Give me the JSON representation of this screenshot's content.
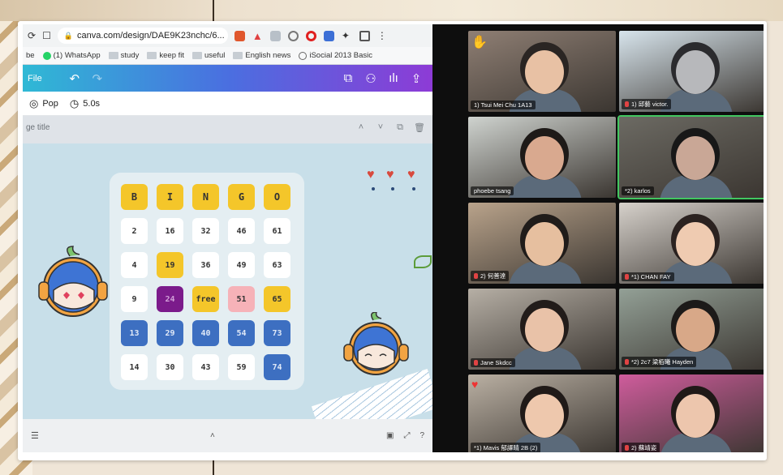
{
  "browser": {
    "url": "canva.com/design/DAE9K23nchc/6...",
    "bookmarks": [
      "be",
      "(1) WhatsApp",
      "study",
      "keep fit",
      "useful",
      "English news",
      "iSocial 2013 Basic"
    ]
  },
  "canva": {
    "file_label": "File",
    "animation_label": "Pop",
    "duration_label": "5.0s",
    "page_title_placeholder": "ge title"
  },
  "bingo": {
    "header": [
      "B",
      "I",
      "N",
      "G",
      "O"
    ],
    "rows": [
      [
        {
          "v": "2",
          "c": "white"
        },
        {
          "v": "16",
          "c": "white"
        },
        {
          "v": "32",
          "c": "white"
        },
        {
          "v": "46",
          "c": "white"
        },
        {
          "v": "61",
          "c": "white"
        }
      ],
      [
        {
          "v": "4",
          "c": "white"
        },
        {
          "v": "19",
          "c": "yellow"
        },
        {
          "v": "36",
          "c": "white"
        },
        {
          "v": "49",
          "c": "white"
        },
        {
          "v": "63",
          "c": "white"
        }
      ],
      [
        {
          "v": "9",
          "c": "white"
        },
        {
          "v": "24",
          "c": "purple"
        },
        {
          "v": "free",
          "c": "yellow"
        },
        {
          "v": "51",
          "c": "pink"
        },
        {
          "v": "65",
          "c": "yellow"
        }
      ],
      [
        {
          "v": "13",
          "c": "blue"
        },
        {
          "v": "29",
          "c": "blue"
        },
        {
          "v": "40",
          "c": "blue"
        },
        {
          "v": "54",
          "c": "blue"
        },
        {
          "v": "73",
          "c": "blue"
        }
      ],
      [
        {
          "v": "14",
          "c": "white"
        },
        {
          "v": "30",
          "c": "white"
        },
        {
          "v": "43",
          "c": "white"
        },
        {
          "v": "59",
          "c": "white"
        },
        {
          "v": "74",
          "c": "blue"
        }
      ]
    ]
  },
  "participants": [
    {
      "name": "1)  Tsui Mei Chu 1A13",
      "bg": "#8f7f74",
      "skin": "#e8c1a4",
      "hair": "#2a2523",
      "hand": true
    },
    {
      "name": "1)  邱藝 victor.",
      "bg": "#d7e4ec",
      "skin": "#b7b8bb",
      "hair": "#2b2b2e",
      "mic": true
    },
    {
      "name": "phoebe tsang",
      "bg": "#cfd3cf",
      "skin": "#d9a98f",
      "hair": "#1e1a18"
    },
    {
      "name": "*2)  karlos",
      "bg": "#6c6a63",
      "skin": "#c9a796",
      "hair": "#181818",
      "active": true
    },
    {
      "name": "2)  何善達",
      "bg": "#b9a38b",
      "skin": "#e6bf9f",
      "hair": "#201c1a",
      "mic": true
    },
    {
      "name": "*1)  CHAN FAY",
      "bg": "#d6d1cb",
      "skin": "#efcbb1",
      "hair": "#2b2220",
      "mic": true
    },
    {
      "name": "Jane Skdcc",
      "bg": "#b6afa5",
      "skin": "#e9c2a8",
      "hair": "#221c1a",
      "mic": true
    },
    {
      "name": "*2)  2c7 梁栢曦 Hayden",
      "bg": "#93a096",
      "skin": "#d8a888",
      "hair": "#1c1a19",
      "mic": true
    },
    {
      "name": "*1)  Mavis 郁譯晴 2B (2)",
      "bg": "#bab0a3",
      "skin": "#eec8ad",
      "hair": "#201a18",
      "heart": true
    },
    {
      "name": "2)  蘇靖姿",
      "bg": "#cf5c9c",
      "skin": "#edc6ad",
      "hair": "#1f1917",
      "mic": true
    }
  ],
  "colors": {
    "canva_gradient_start": "#2fb9d5",
    "canva_gradient_end": "#8d3bd6",
    "bingo_yellow": "#f4c62a",
    "bingo_blue": "#3d6fc1",
    "bingo_purple": "#7b1b8b",
    "bingo_pink": "#f6b2b8",
    "active_speaker": "#42c760"
  }
}
